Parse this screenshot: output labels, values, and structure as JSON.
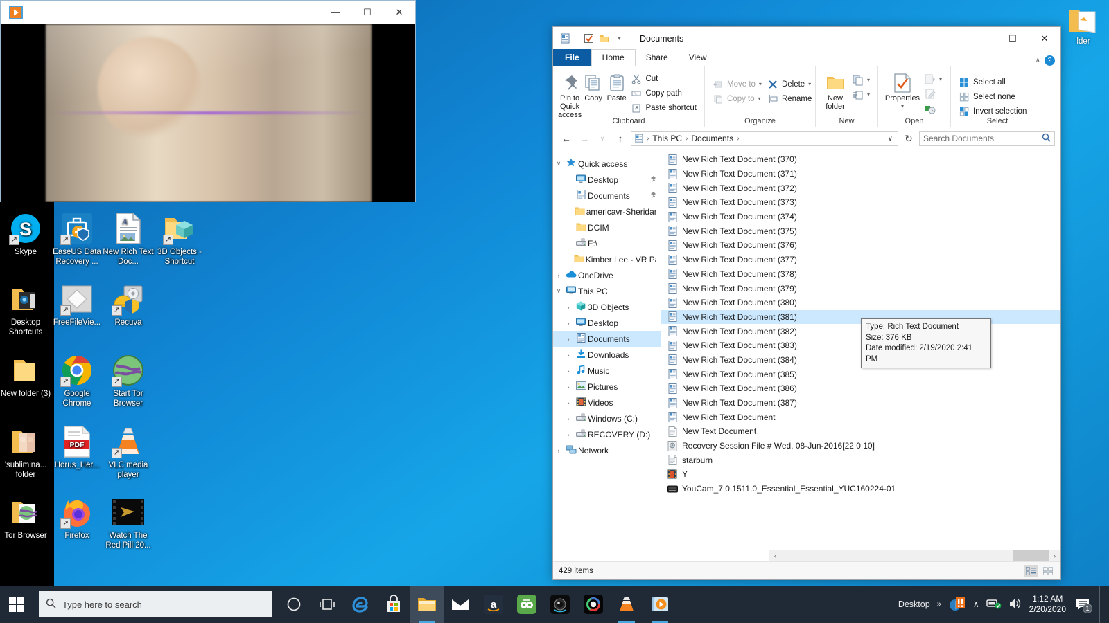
{
  "desktop": {
    "icons": [
      {
        "name": "Skype",
        "label": "Skype",
        "icon": "skype-icon",
        "shortcut": true
      },
      {
        "name": "EaseUS Data Recovery",
        "label": "EaseUS Data Recovery ...",
        "icon": "easeus-icon",
        "shortcut": true
      },
      {
        "name": "New Rich Text Doc",
        "label": "New Rich Text Doc...",
        "icon": "rtf-icon",
        "shortcut": false
      },
      {
        "name": "3D Objects - Shortcut",
        "label": "3D Objects - Shortcut",
        "icon": "3d-objects-folder-icon",
        "shortcut": true
      },
      {
        "name": "Desktop Shortcuts",
        "label": "Desktop Shortcuts",
        "icon": "folder-icon",
        "shortcut": false
      },
      {
        "name": "FreeFileViewer",
        "label": "FreeFileVie...",
        "icon": "freefileviewer-icon",
        "shortcut": true
      },
      {
        "name": "Recuva",
        "label": "Recuva",
        "icon": "recuva-icon",
        "shortcut": true
      },
      {
        "name": "New folder (3)",
        "label": "New folder (3)",
        "icon": "folder-icon",
        "shortcut": false
      },
      {
        "name": "Google Chrome",
        "label": "Google Chrome",
        "icon": "chrome-icon",
        "shortcut": true
      },
      {
        "name": "Start Tor Browser",
        "label": "Start Tor Browser",
        "icon": "tor-icon",
        "shortcut": true
      },
      {
        "name": "subliminal folder",
        "label": "'sublimina... folder",
        "icon": "folder-icon",
        "shortcut": false
      },
      {
        "name": "Horus_Her PDF",
        "label": "Horus_Her...",
        "icon": "pdf-icon",
        "shortcut": false
      },
      {
        "name": "VLC media player",
        "label": "VLC media player",
        "icon": "vlc-icon",
        "shortcut": true
      },
      {
        "name": "Tor Browser",
        "label": "Tor Browser",
        "icon": "folder-icon",
        "shortcut": false
      },
      {
        "name": "Firefox",
        "label": "Firefox",
        "icon": "firefox-icon",
        "shortcut": true
      },
      {
        "name": "Watch The Red Pill 20",
        "label": "Watch The Red Pill 20...",
        "icon": "video-icon",
        "shortcut": false
      }
    ],
    "right_edge_icon": {
      "label": "lder",
      "icon": "folder-icon"
    }
  },
  "media_player": {
    "title": "",
    "app_icon": "play-icon",
    "minimize": "—",
    "maximize": "☐",
    "close": "✕"
  },
  "explorer": {
    "title": "Documents",
    "quick_access_toolbar": [
      {
        "name": "properties-qat-icon",
        "glyph": "🗎"
      },
      {
        "name": "checkbox-qat-icon",
        "glyph": "☑"
      },
      {
        "name": "new-folder-qat-icon",
        "glyph": "🗀"
      },
      {
        "name": "customize-qat-icon",
        "glyph": "▾"
      }
    ],
    "window_controls": {
      "minimize": "—",
      "maximize": "☐",
      "close": "✕"
    },
    "tabs": [
      {
        "label": "File",
        "active": false,
        "kind": "file"
      },
      {
        "label": "Home",
        "active": true,
        "kind": "normal"
      },
      {
        "label": "Share",
        "active": false,
        "kind": "normal"
      },
      {
        "label": "View",
        "active": false,
        "kind": "normal"
      }
    ],
    "tab_right": {
      "collapse_ribbon": "∧",
      "help": "?"
    },
    "ribbon": {
      "groups": [
        {
          "label": "Clipboard",
          "big": [
            {
              "label": "Pin to Quick access",
              "icon": "pin-icon",
              "glyph": "📌"
            },
            {
              "label": "Copy",
              "icon": "copy-icon",
              "glyph": "❐"
            },
            {
              "label": "Paste",
              "icon": "paste-icon",
              "glyph": "📋"
            }
          ],
          "small": [
            {
              "label": "Cut",
              "icon": "cut-icon",
              "glyph": "✂",
              "disabled": false
            },
            {
              "label": "Copy path",
              "icon": "copy-path-icon",
              "glyph": "▤",
              "disabled": false
            },
            {
              "label": "Paste shortcut",
              "icon": "paste-shortcut-icon",
              "glyph": "📋",
              "disabled": false
            }
          ]
        },
        {
          "label": "Organize",
          "big": [],
          "small": [
            {
              "label": "Move to",
              "icon": "move-to-icon",
              "glyph": "⇦",
              "disabled": true,
              "caret": true
            },
            {
              "label": "Copy to",
              "icon": "copy-to-icon",
              "glyph": "❐",
              "disabled": true,
              "caret": true
            },
            {
              "label": "Delete",
              "icon": "delete-icon",
              "glyph": "✖",
              "disabled": false,
              "caret": true
            },
            {
              "label": "Rename",
              "icon": "rename-icon",
              "glyph": "⌸",
              "disabled": false,
              "caret": false
            }
          ]
        },
        {
          "label": "New",
          "big": [
            {
              "label": "New folder",
              "icon": "new-folder-icon",
              "glyph": "🗀"
            }
          ],
          "small": [
            {
              "label": "",
              "icon": "new-item-icon",
              "glyph": "❐",
              "disabled": false,
              "caret": true
            },
            {
              "label": "",
              "icon": "easy-access-icon",
              "glyph": "☷",
              "disabled": false,
              "caret": true
            }
          ]
        },
        {
          "label": "Open",
          "big": [
            {
              "label": "Properties",
              "icon": "properties-icon",
              "glyph": "✔"
            }
          ],
          "small": [
            {
              "label": "",
              "icon": "open-icon",
              "glyph": "▤",
              "disabled": true,
              "caret": true
            },
            {
              "label": "",
              "icon": "edit-icon",
              "glyph": "✎",
              "disabled": true,
              "caret": false
            },
            {
              "label": "",
              "icon": "history-icon",
              "glyph": "↺",
              "disabled": false,
              "caret": false
            }
          ]
        },
        {
          "label": "Select",
          "big": [],
          "small": [
            {
              "label": "Select all",
              "icon": "select-all-icon",
              "glyph": "▣",
              "disabled": false,
              "caret": false
            },
            {
              "label": "Select none",
              "icon": "select-none-icon",
              "glyph": "⬚",
              "disabled": false,
              "caret": false
            },
            {
              "label": "Invert selection",
              "icon": "invert-selection-icon",
              "glyph": "◫",
              "disabled": false,
              "caret": false
            }
          ]
        }
      ]
    },
    "address_bar": {
      "back": "←",
      "forward": "→",
      "recent": "∨",
      "up": "↑",
      "path_icon": "documents-icon",
      "crumbs": [
        "This PC",
        "Documents"
      ],
      "separator": "›",
      "dropdown": "∨",
      "refresh": "↻"
    },
    "search": {
      "placeholder": "Search Documents",
      "value": "",
      "icon": "search-icon"
    },
    "nav_tree": [
      {
        "label": "Quick access",
        "icon": "star-icon",
        "glyph": "★",
        "chev": "∨",
        "indent": 0,
        "selected": false,
        "pin": false
      },
      {
        "label": "Desktop",
        "icon": "desktop-icon",
        "glyph": "🖥",
        "chev": "",
        "indent": 1,
        "selected": false,
        "pin": true
      },
      {
        "label": "Documents",
        "icon": "documents-icon",
        "glyph": "🗎",
        "chev": "",
        "indent": 1,
        "selected": false,
        "pin": true
      },
      {
        "label": "americavr-Sheridan.",
        "icon": "folder-icon",
        "glyph": "🗀",
        "chev": "",
        "indent": 1,
        "selected": false,
        "pin": false
      },
      {
        "label": "DCIM",
        "icon": "folder-icon",
        "glyph": "🗀",
        "chev": "",
        "indent": 1,
        "selected": false,
        "pin": false
      },
      {
        "label": "F:\\",
        "icon": "drive-icon",
        "glyph": "💾",
        "chev": "",
        "indent": 1,
        "selected": false,
        "pin": false
      },
      {
        "label": "Kimber Lee - VR Pac",
        "icon": "folder-icon",
        "glyph": "🗀",
        "chev": "",
        "indent": 1,
        "selected": false,
        "pin": false
      },
      {
        "label": "OneDrive",
        "icon": "onedrive-icon",
        "glyph": "☁",
        "chev": "›",
        "indent": 0,
        "selected": false,
        "pin": false
      },
      {
        "label": "This PC",
        "icon": "this-pc-icon",
        "glyph": "🖥",
        "chev": "∨",
        "indent": 0,
        "selected": false,
        "pin": false
      },
      {
        "label": "3D Objects",
        "icon": "3d-objects-icon",
        "glyph": "⬡",
        "chev": "›",
        "indent": 1,
        "selected": false,
        "pin": false
      },
      {
        "label": "Desktop",
        "icon": "desktop-icon",
        "glyph": "🖥",
        "chev": "›",
        "indent": 1,
        "selected": false,
        "pin": false
      },
      {
        "label": "Documents",
        "icon": "documents-icon",
        "glyph": "🗎",
        "chev": "›",
        "indent": 1,
        "selected": true,
        "pin": false
      },
      {
        "label": "Downloads",
        "icon": "downloads-icon",
        "glyph": "⬇",
        "chev": "›",
        "indent": 1,
        "selected": false,
        "pin": false
      },
      {
        "label": "Music",
        "icon": "music-icon",
        "glyph": "♪",
        "chev": "›",
        "indent": 1,
        "selected": false,
        "pin": false
      },
      {
        "label": "Pictures",
        "icon": "pictures-icon",
        "glyph": "🏞",
        "chev": "›",
        "indent": 1,
        "selected": false,
        "pin": false
      },
      {
        "label": "Videos",
        "icon": "videos-icon",
        "glyph": "🎞",
        "chev": "›",
        "indent": 1,
        "selected": false,
        "pin": false
      },
      {
        "label": "Windows (C:)",
        "icon": "drive-icon",
        "glyph": "💽",
        "chev": "›",
        "indent": 1,
        "selected": false,
        "pin": false
      },
      {
        "label": "RECOVERY (D:)",
        "icon": "drive-icon",
        "glyph": "💽",
        "chev": "›",
        "indent": 1,
        "selected": false,
        "pin": false
      },
      {
        "label": "Network",
        "icon": "network-icon",
        "glyph": "🗂",
        "chev": "›",
        "indent": 0,
        "selected": false,
        "pin": false
      }
    ],
    "files": [
      {
        "name": "New Rich Text Document (370)",
        "icon": "rtf-icon",
        "selected": false
      },
      {
        "name": "New Rich Text Document (371)",
        "icon": "rtf-icon",
        "selected": false
      },
      {
        "name": "New Rich Text Document (372)",
        "icon": "rtf-icon",
        "selected": false
      },
      {
        "name": "New Rich Text Document (373)",
        "icon": "rtf-icon",
        "selected": false
      },
      {
        "name": "New Rich Text Document (374)",
        "icon": "rtf-icon",
        "selected": false
      },
      {
        "name": "New Rich Text Document (375)",
        "icon": "rtf-icon",
        "selected": false
      },
      {
        "name": "New Rich Text Document (376)",
        "icon": "rtf-icon",
        "selected": false
      },
      {
        "name": "New Rich Text Document (377)",
        "icon": "rtf-icon",
        "selected": false
      },
      {
        "name": "New Rich Text Document (378)",
        "icon": "rtf-icon",
        "selected": false
      },
      {
        "name": "New Rich Text Document (379)",
        "icon": "rtf-icon",
        "selected": false
      },
      {
        "name": "New Rich Text Document (380)",
        "icon": "rtf-icon",
        "selected": false
      },
      {
        "name": "New Rich Text Document (381)",
        "icon": "rtf-icon",
        "selected": true
      },
      {
        "name": "New Rich Text Document (382)",
        "icon": "rtf-icon",
        "selected": false
      },
      {
        "name": "New Rich Text Document (383)",
        "icon": "rtf-icon",
        "selected": false
      },
      {
        "name": "New Rich Text Document (384)",
        "icon": "rtf-icon",
        "selected": false
      },
      {
        "name": "New Rich Text Document (385)",
        "icon": "rtf-icon",
        "selected": false
      },
      {
        "name": "New Rich Text Document (386)",
        "icon": "rtf-icon",
        "selected": false
      },
      {
        "name": "New Rich Text Document (387)",
        "icon": "rtf-icon",
        "selected": false
      },
      {
        "name": "New Rich Text Document",
        "icon": "rtf-icon",
        "selected": false
      },
      {
        "name": "New Text Document",
        "icon": "txt-icon",
        "selected": false
      },
      {
        "name": "Recovery Session File # Wed, 08-Jun-2016[22 0 10]",
        "icon": "recovery-session-icon",
        "selected": false
      },
      {
        "name": "starburn",
        "icon": "txt-icon",
        "selected": false
      },
      {
        "name": "Y",
        "icon": "video-icon",
        "selected": false
      },
      {
        "name": "YouCam_7.0.1511.0_Essential_Essential_YUC160224-01",
        "icon": "exe-icon",
        "selected": false
      }
    ],
    "tooltip": {
      "type": "Type: Rich Text Document",
      "size": "Size: 376 KB",
      "modified": "Date modified: 2/19/2020 2:41 PM"
    },
    "status": {
      "item_count": "429 items"
    },
    "view_buttons": [
      {
        "name": "details-view-button",
        "glyph": "☷",
        "active": true
      },
      {
        "name": "large-icons-view-button",
        "glyph": "▦",
        "active": false
      }
    ],
    "scrollbar": {
      "left_arrow": "‹",
      "right_arrow": "›"
    }
  },
  "taskbar": {
    "start": {
      "name": "start-button",
      "glyph": "⊞"
    },
    "search": {
      "placeholder": "Type here to search",
      "value": "",
      "icon": "search-icon"
    },
    "buttons": [
      {
        "name": "cortana-button",
        "glyph": "○",
        "state": "none"
      },
      {
        "name": "task-view-button",
        "glyph": "⌸",
        "state": "none"
      },
      {
        "name": "edge-button",
        "glyph": "e",
        "state": "none"
      },
      {
        "name": "microsoft-store-button",
        "glyph": "🛍",
        "state": "none"
      },
      {
        "name": "file-explorer-button",
        "glyph": "🗀",
        "state": "active"
      },
      {
        "name": "mail-button",
        "glyph": "✉",
        "state": "none"
      },
      {
        "name": "amazon-button",
        "glyph": "a",
        "state": "none"
      },
      {
        "name": "tripadvisor-button",
        "glyph": "◎",
        "state": "none"
      },
      {
        "name": "camera-app-button",
        "glyph": "◉",
        "state": "none"
      },
      {
        "name": "youcam-button",
        "glyph": "◉",
        "state": "none"
      },
      {
        "name": "vlc-button",
        "glyph": "▲",
        "state": "running"
      },
      {
        "name": "media-player-button",
        "glyph": "▶",
        "state": "running"
      }
    ],
    "tray": {
      "desktop_label": "Desktop",
      "overflow": "»",
      "warning_icon": "warning-icon",
      "show_hidden": "∧",
      "network_icon": "network-icon",
      "volume_icon": "volume-icon",
      "time": "1:12 AM",
      "date": "2/20/2020",
      "notification_badge": "1"
    }
  },
  "colors": {
    "accent": "#0b5ca3",
    "selection": "#cce8ff",
    "taskbar": "#1f2a36",
    "desktop": "#1186d4"
  }
}
